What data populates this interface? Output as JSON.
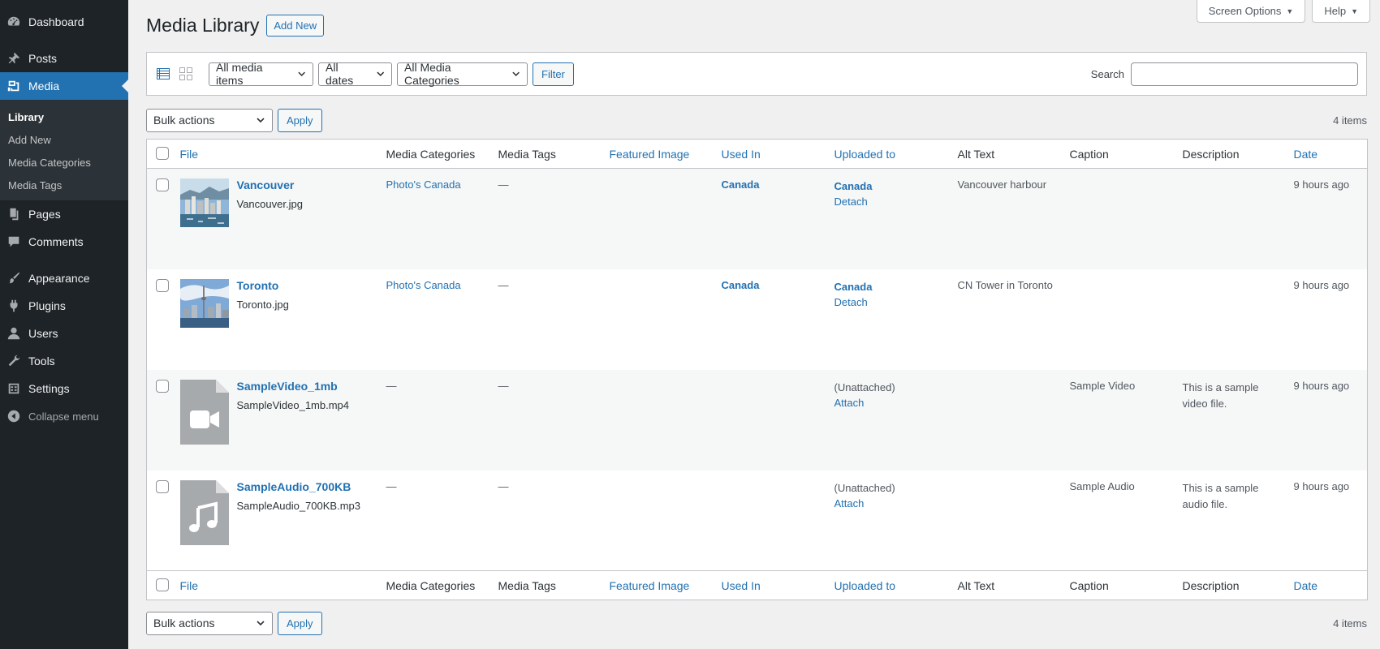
{
  "sidebar": {
    "dashboard": "Dashboard",
    "posts": "Posts",
    "media": "Media",
    "submenu": [
      "Library",
      "Add New",
      "Media Categories",
      "Media Tags"
    ],
    "pages": "Pages",
    "comments": "Comments",
    "appearance": "Appearance",
    "plugins": "Plugins",
    "users": "Users",
    "tools": "Tools",
    "settings": "Settings",
    "collapse": "Collapse menu"
  },
  "screen_meta": {
    "screen_options": "Screen Options",
    "help": "Help"
  },
  "header": {
    "title": "Media Library",
    "add_new": "Add New"
  },
  "filters": {
    "media_type": "All media items",
    "dates": "All dates",
    "categories": "All Media Categories",
    "filter_button": "Filter",
    "search_label": "Search",
    "search_value": ""
  },
  "tablenav": {
    "bulk_actions": "Bulk actions",
    "apply": "Apply",
    "count": "4 items"
  },
  "columns": [
    "File",
    "Media Categories",
    "Media Tags",
    "Featured Image",
    "Used In",
    "Uploaded to",
    "Alt Text",
    "Caption",
    "Description",
    "Date"
  ],
  "rows": [
    {
      "title": "Vancouver",
      "filename": "Vancouver.jpg",
      "thumb": "vancouver-photo",
      "categories": "Photo's Canada",
      "tags": "—",
      "featured": "",
      "used_in": "Canada",
      "uploaded_to": "Canada",
      "uploaded_action": "Detach",
      "alt": "Vancouver harbour",
      "caption": "",
      "description": "",
      "date": "9 hours ago"
    },
    {
      "title": "Toronto",
      "filename": "Toronto.jpg",
      "thumb": "toronto-photo",
      "categories": "Photo's Canada",
      "tags": "—",
      "featured": "",
      "used_in": "Canada",
      "uploaded_to": "Canada",
      "uploaded_action": "Detach",
      "alt": "CN Tower in Toronto",
      "caption": "",
      "description": "",
      "date": "9 hours ago"
    },
    {
      "title": "SampleVideo_1mb",
      "filename": "SampleVideo_1mb.mp4",
      "thumb": "video-file-icon",
      "categories": "—",
      "tags": "—",
      "featured": "",
      "used_in": "",
      "uploaded_to": "(Unattached)",
      "uploaded_action": "Attach",
      "alt": "",
      "caption": "Sample Video",
      "description": "This is a sample video file.",
      "date": "9 hours ago"
    },
    {
      "title": "SampleAudio_700KB",
      "filename": "SampleAudio_700KB.mp3",
      "thumb": "audio-file-icon",
      "categories": "—",
      "tags": "—",
      "featured": "",
      "used_in": "",
      "uploaded_to": "(Unattached)",
      "uploaded_action": "Attach",
      "alt": "",
      "caption": "Sample Audio",
      "description": "This is a sample audio file.",
      "date": "9 hours ago"
    }
  ]
}
